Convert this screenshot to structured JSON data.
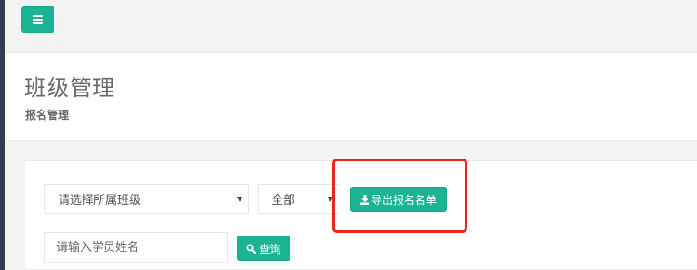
{
  "topbar": {
    "menu_icon": "hamburger-icon"
  },
  "header": {
    "title": "班级管理",
    "breadcrumb": "报名管理"
  },
  "filters": {
    "class_select": {
      "selected": "请选择所属班级"
    },
    "status_select": {
      "selected": "全部"
    },
    "export_button": {
      "label": "导出报名名单",
      "icon": "download-icon"
    },
    "name_input": {
      "placeholder": "请输入学员姓名",
      "value": ""
    },
    "search_button": {
      "label": "查询",
      "icon": "search-icon"
    }
  },
  "colors": {
    "accent": "#1ab394",
    "highlight": "#e8261b"
  }
}
